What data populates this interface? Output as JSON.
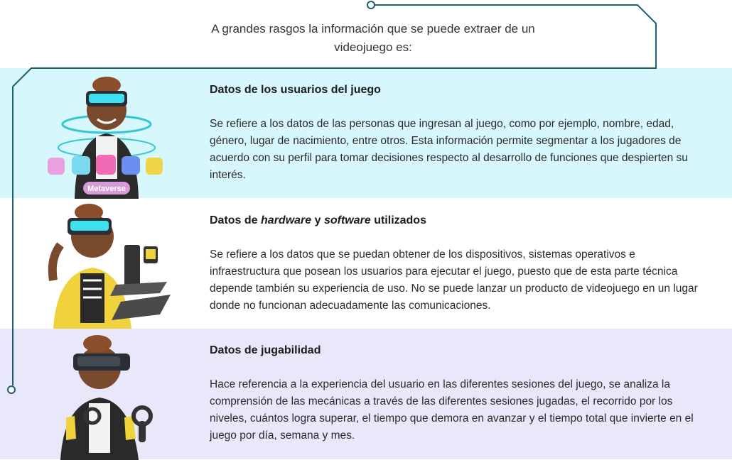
{
  "intro": "A grandes rasgos la información que se puede extraer de un videojuego es:",
  "cards": [
    {
      "title": "Datos de los usuarios del juego",
      "text": "Se refiere a los datos de las personas que ingresan al juego, como por ejemplo, nombre, edad, género, lugar de nacimiento, entre otros. Esta información permite segmentar a los jugadores de acuerdo con su perfil para tomar decisiones respecto al desarrollo de funciones que despierten su interés.",
      "badge": "Metaverse",
      "illustration": "vr-avatar-metaverse"
    },
    {
      "title_parts": [
        "Datos de ",
        "hardware",
        " y ",
        "software",
        " utilizados"
      ],
      "text": "Se refiere a los datos que se puedan obtener de los dispositivos, sistemas operativos e infraestructura que posean los usuarios para ejecutar el juego, puesto que de esta parte técnica depende también su experiencia de uso. No se puede lanzar un producto de videojuego en un lugar donde no funcionan adecuadamente las comunicaciones.",
      "illustration": "vr-avatar-devices"
    },
    {
      "title": "Datos de jugabilidad",
      "text": "Hace referencia a la experiencia del usuario en las diferentes sesiones del juego, se analiza la comprensión de las mecánicas a través de las diferentes sesiones jugadas, el recorrido por los niveles, cuántos logra superar, el tiempo que demora en avanzar y el tiempo total que invierte en el juego por día, semana y mes.",
      "illustration": "vr-avatar-controllers"
    }
  ],
  "colors": {
    "band1": "#d6f7fb",
    "band3": "#e9e8fb",
    "line": "#1e5f74"
  }
}
